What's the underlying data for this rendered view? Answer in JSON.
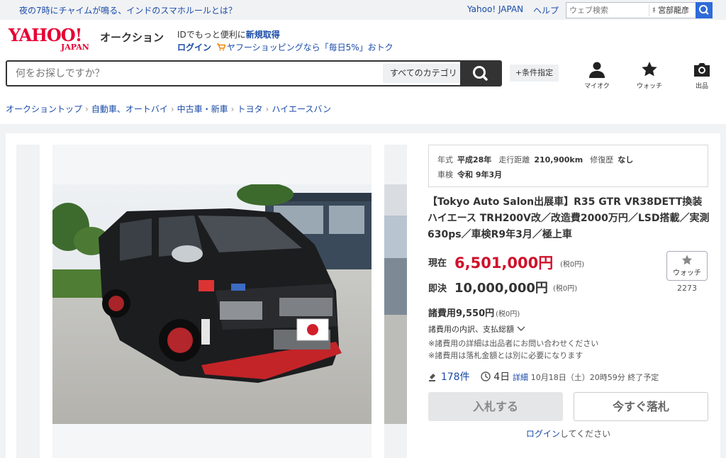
{
  "topbar": {
    "news": "夜の7時にチャイムが鳴る、インドのスマホルールとは？",
    "yahoo_japan": "Yahoo! JAPAN",
    "help": "ヘルプ",
    "web_search_placeholder": "ウェブ検索",
    "user_name": "宮部龍彦"
  },
  "header": {
    "logo_main": "YAHOO!",
    "logo_sub": "JAPAN",
    "service_name": "オークション",
    "id_text": "IDでもっと便利に",
    "id_link": "新規取得",
    "login": "ログイン",
    "shopping_promo": "ヤフーショッピングなら「毎日5%」おトク"
  },
  "search": {
    "placeholder": "何をお探しですか？",
    "category": "すべてのカテゴリ",
    "condition": "+条件指定"
  },
  "nav": {
    "my_auction": "マイオク",
    "watch": "ウォッチ",
    "sell": "出品"
  },
  "breadcrumb": [
    "オークショントップ",
    "自動車、オートバイ",
    "中古車・新車",
    "トヨタ",
    "ハイエースバン"
  ],
  "specs": {
    "year_label": "年式",
    "year": "平成28年",
    "mileage_label": "走行距離",
    "mileage": "210,900km",
    "repair_label": "修復歴",
    "repair": "なし",
    "inspection_label": "車検",
    "inspection": "令和 9年3月"
  },
  "item": {
    "title": "【Tokyo Auto Salon出展車】R35 GTR VR38DETT換装ハイエース TRH200V改／改造費2000万円／LSD搭載／実測630ps／車検R9年3月／極上車",
    "current_label": "現在",
    "current_price": "6,501,000円",
    "current_tax": "(税0円)",
    "buynow_label": "即決",
    "buynow_price": "10,000,000円",
    "buynow_tax": "(税0円)",
    "watch_label": "ウォッチ",
    "watch_count": "2273",
    "fee": "諸費用9,550円",
    "fee_tax": "(税0円)",
    "fee_link": "諸費用の内訳、支払総額",
    "note1": "※諸費用の詳細は出品者にお問い合わせください",
    "note2": "※諸費用は落札金額とは別に必要になります",
    "bids": "178件",
    "time_left": "4日",
    "detail": "詳細",
    "end_time": "10月18日（土）20時59分 終了予定",
    "bid_button": "入札する",
    "buynow_button": "今すぐ落札",
    "login_link": "ログイン",
    "login_suffix": "してください"
  },
  "colors": {
    "accent_red": "#d0112b",
    "link_blue": "#1a4ba8",
    "yahoo_red": "#e60033"
  }
}
